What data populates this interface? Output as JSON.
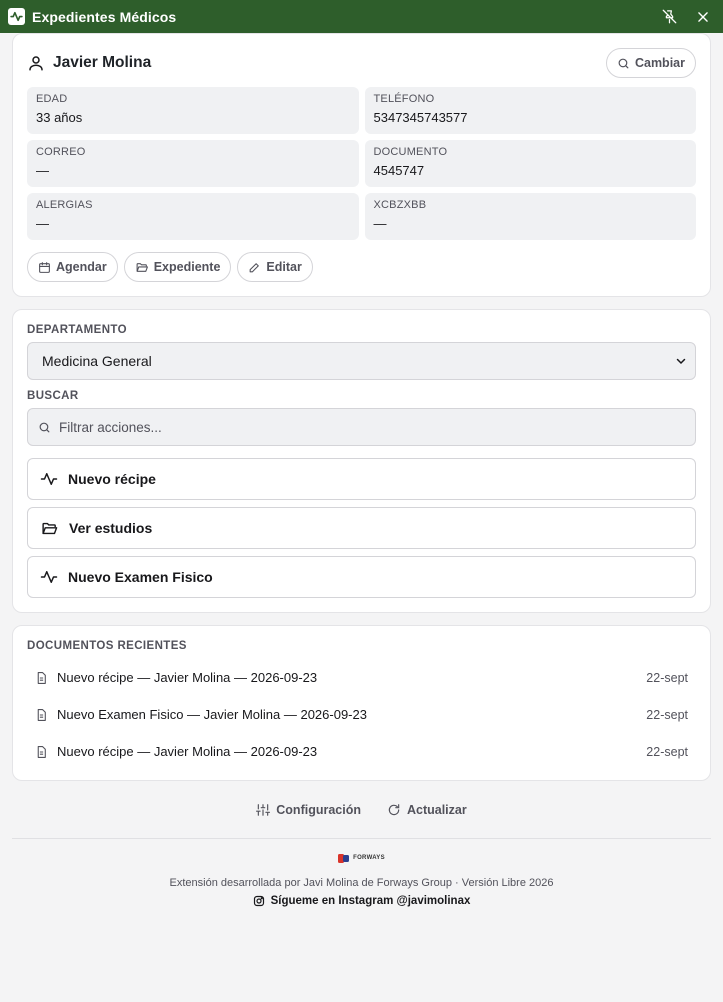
{
  "window": {
    "title": "Expedientes Médicos",
    "accent": "#2e5e2b"
  },
  "patient": {
    "name": "Javier Molina",
    "change_label": "Cambiar",
    "fields": [
      {
        "label": "EDAD",
        "value": "33 años"
      },
      {
        "label": "TELÉFONO",
        "value": "5347345743577"
      },
      {
        "label": "CORREO",
        "value": "—"
      },
      {
        "label": "DOCUMENTO",
        "value": "4545747"
      },
      {
        "label": "ALERGIAS",
        "value": "—"
      },
      {
        "label": "XCBZXBB",
        "value": "—"
      }
    ],
    "actions": {
      "schedule_label": "Agendar",
      "record_label": "Expediente",
      "edit_label": "Editar"
    }
  },
  "department": {
    "label": "DEPARTAMENTO",
    "selected": "Medicina General"
  },
  "search": {
    "label": "BUSCAR",
    "placeholder": "Filtrar acciones...",
    "value": ""
  },
  "quick_actions": [
    {
      "label": "Nuevo récipe",
      "icon": "activity-icon"
    },
    {
      "label": "Ver estudios",
      "icon": "folder-open-icon"
    },
    {
      "label": "Nuevo Examen Fisico",
      "icon": "activity-icon"
    }
  ],
  "recent_docs": {
    "label": "DOCUMENTOS RECIENTES",
    "items": [
      {
        "title": "Nuevo récipe — Javier Molina — 2026-09-23",
        "date": "22-sept"
      },
      {
        "title": "Nuevo Examen Fisico — Javier Molina — 2026-09-23",
        "date": "22-sept"
      },
      {
        "title": "Nuevo récipe — Javier Molina — 2026-09-23",
        "date": "22-sept"
      }
    ]
  },
  "footer": {
    "settings_label": "Configuración",
    "refresh_label": "Actualizar",
    "brand": "FORWAYS",
    "credits": "Extensión desarrollada por Javi Molina de Forways Group · Versión Libre 2026",
    "instagram": "Sígueme en Instagram @javimolinax"
  }
}
